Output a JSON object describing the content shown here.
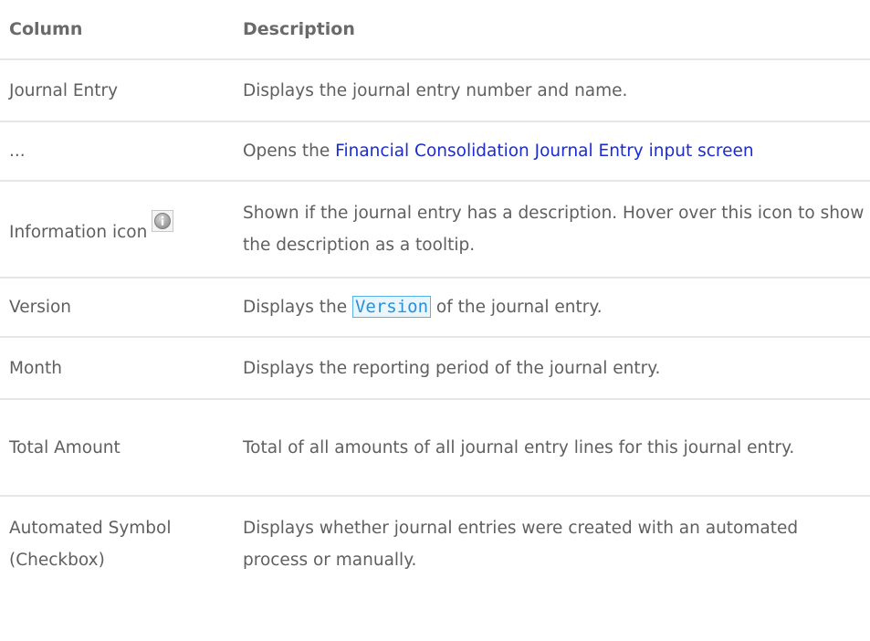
{
  "table": {
    "headers": {
      "column": "Column",
      "description": "Description"
    },
    "rows": [
      {
        "column": "Journal Entry",
        "description": "Displays the journal entry number and name."
      },
      {
        "column": "...",
        "description_prefix": "Opens the ",
        "description_link": "Financial Consolidation Journal Entry input screen"
      },
      {
        "column": "Information icon",
        "icon": "info-icon",
        "description": "Shown if the journal entry has a description. Hover over this icon to show the description as a tooltip."
      },
      {
        "column": "Version",
        "description_prefix": "Displays the ",
        "description_code": "Version",
        "description_suffix": " of the journal entry."
      },
      {
        "column": "Month",
        "description": "Displays the reporting period of the journal entry."
      },
      {
        "column": "Total Amount",
        "description": "Total of all amounts of all journal entry lines for this journal entry."
      },
      {
        "column": "Automated Symbol (Checkbox)",
        "description": "Displays whether journal entries were created with an automated process or manually."
      }
    ]
  },
  "colors": {
    "link": "#1b2bd6",
    "code_text": "#2a8fd6",
    "code_border": "#58b2ea",
    "divider": "#e6e6e6"
  }
}
